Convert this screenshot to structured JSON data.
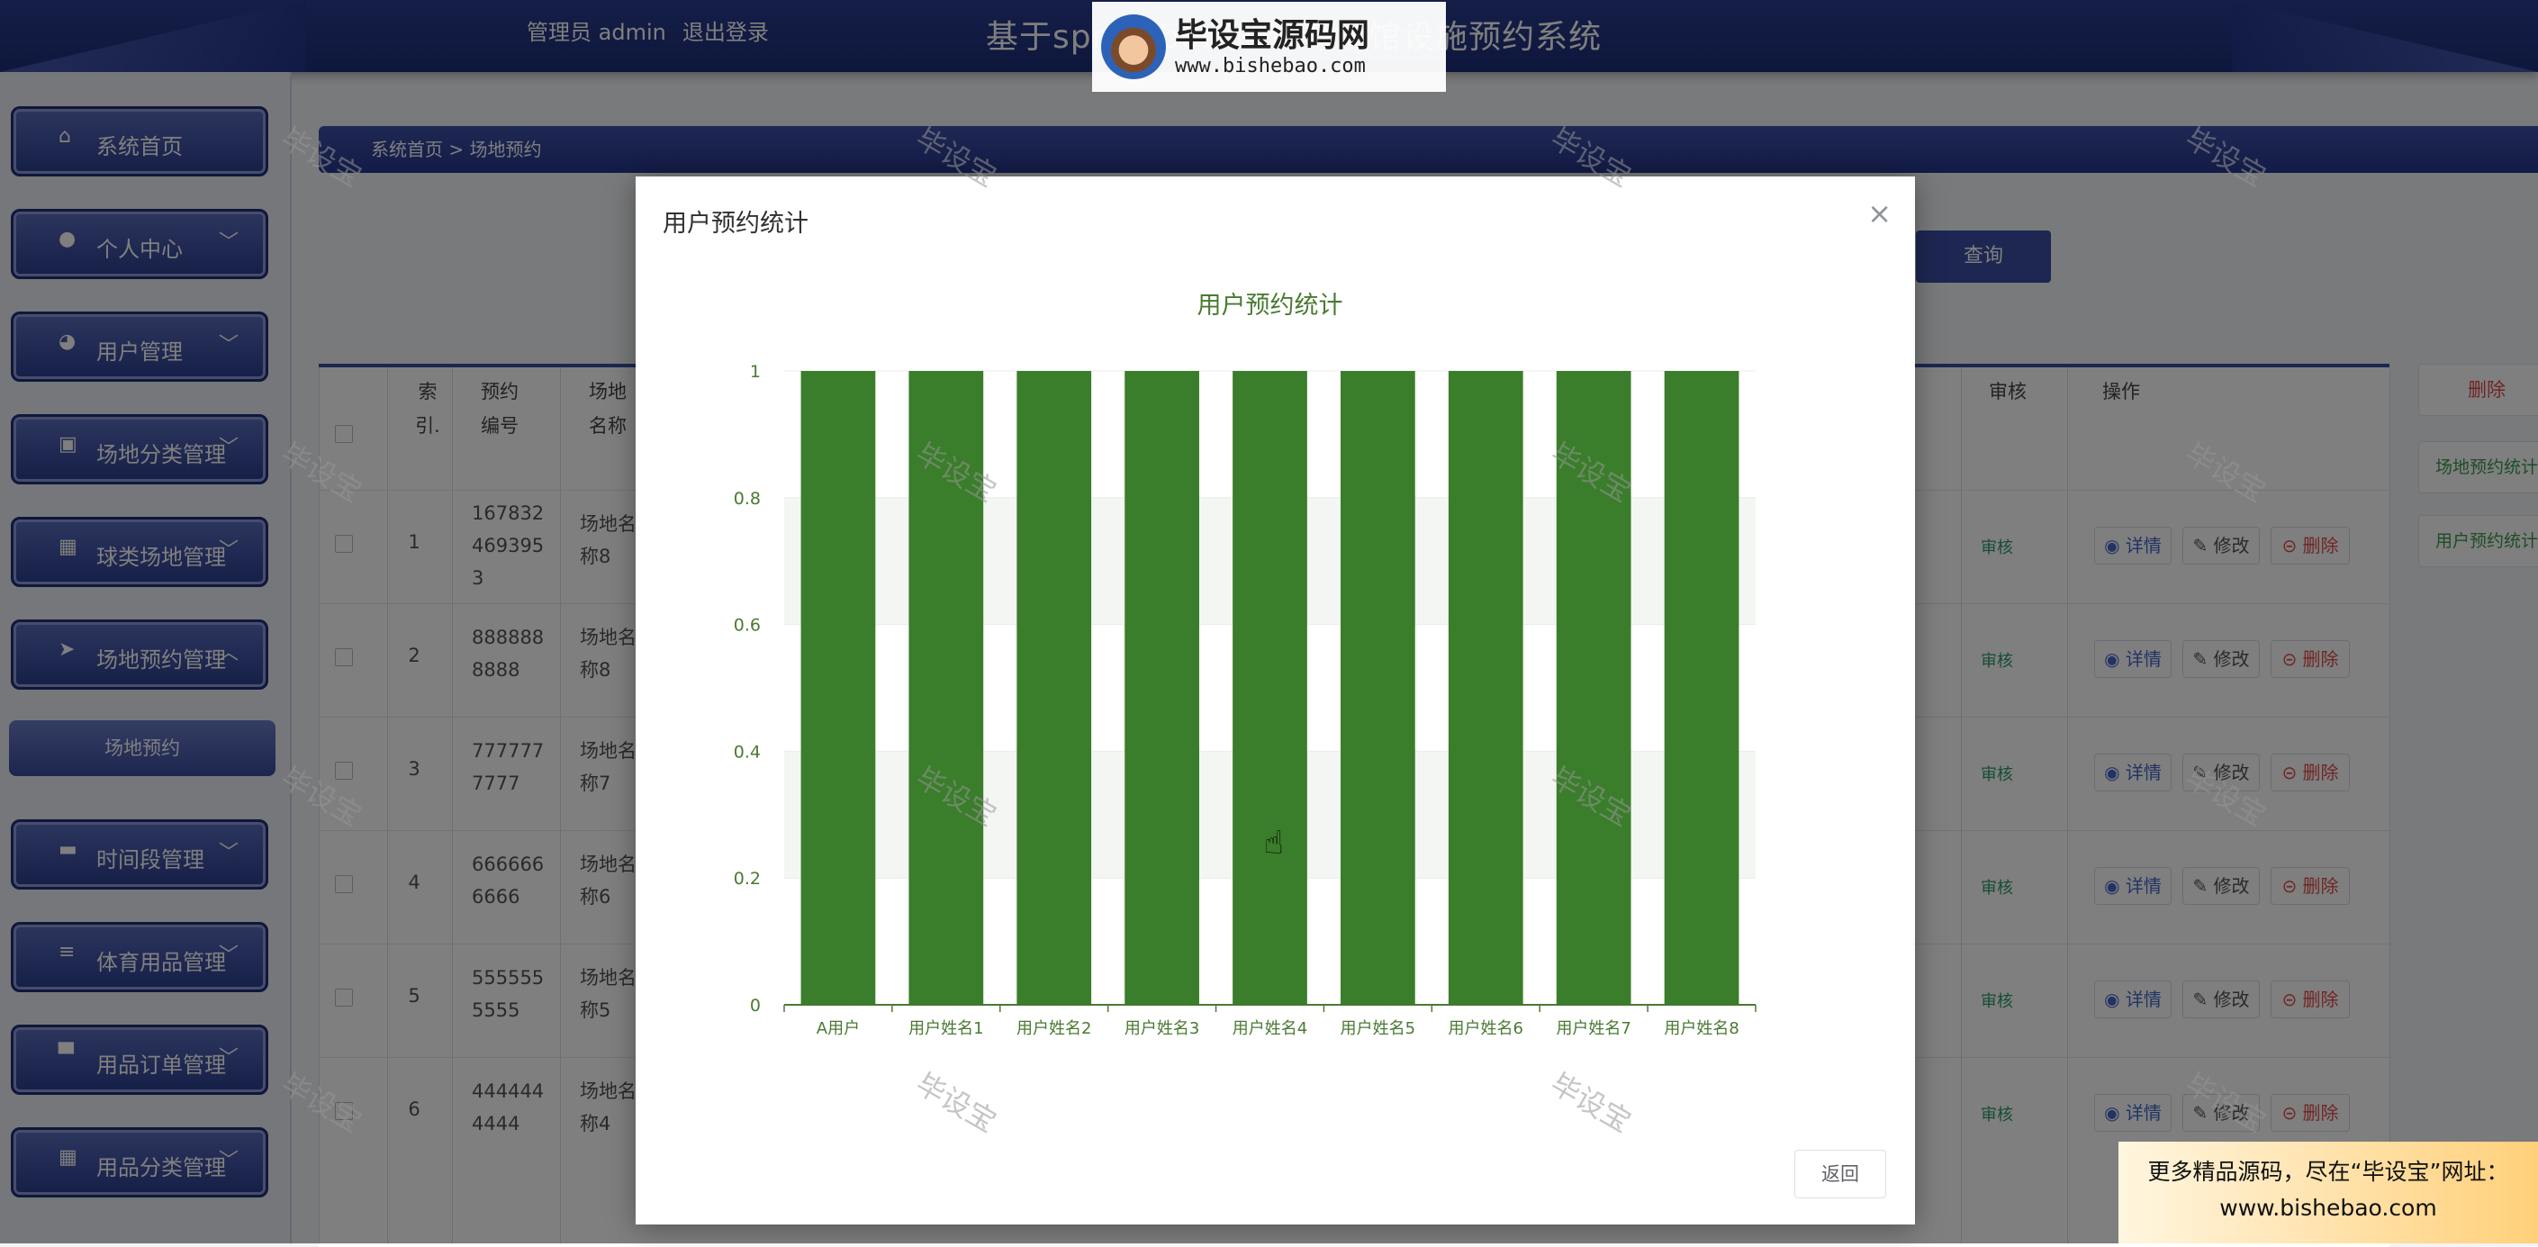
{
  "header": {
    "user_role": "管理员 admin",
    "logout": "退出登录",
    "system_title": "基于springboot的体育场馆设施预约系统"
  },
  "watermark": {
    "logo_title": "毕设宝源码网",
    "logo_url": "www.bishebao.com",
    "tile_text": "毕设宝",
    "corner_ad_line1": "更多精品源码，尽在“毕设宝”网址：",
    "corner_ad_line2": "www.bishebao.com"
  },
  "sidebar": {
    "items": [
      {
        "label": "系统首页",
        "icon": "home-icon",
        "chevron": ""
      },
      {
        "label": "个人中心",
        "icon": "user-icon",
        "chevron": "﹀"
      },
      {
        "label": "用户管理",
        "icon": "palette-icon",
        "chevron": "﹀"
      },
      {
        "label": "场地分类管理",
        "icon": "calendar-x-icon",
        "chevron": "﹀"
      },
      {
        "label": "球类场地管理",
        "icon": "grid-icon",
        "chevron": "﹀"
      },
      {
        "label": "场地预约管理",
        "icon": "send-icon",
        "chevron": "︿"
      },
      {
        "label": "时间段管理",
        "icon": "briefcase-icon",
        "chevron": "﹀"
      },
      {
        "label": "体育用品管理",
        "icon": "list-icon",
        "chevron": "﹀"
      },
      {
        "label": "用品订单管理",
        "icon": "monitor-icon",
        "chevron": "﹀"
      },
      {
        "label": "用品分类管理",
        "icon": "grid-icon",
        "chevron": "﹀"
      }
    ],
    "sub_item": "场地预约"
  },
  "main": {
    "breadcrumb": "系统首页  >  场地预约",
    "query_button": "查询",
    "right_buttons": [
      "删除",
      "场地预约统计",
      "用户预约统计"
    ],
    "columns": {
      "index": "索\n引.",
      "booking_no": "预约\n编号",
      "venue_name": "场地\n名称",
      "audit": "审核",
      "operation": "操作"
    },
    "rows": [
      {
        "index": "1",
        "booking_no": "167832\n469395\n3",
        "venue": "场地名\n称8",
        "audit": "审核"
      },
      {
        "index": "2",
        "booking_no": "888888\n8888",
        "venue": "场地名\n称8",
        "audit": "审核"
      },
      {
        "index": "3",
        "booking_no": "777777\n7777",
        "venue": "场地名\n称7",
        "audit": "审核"
      },
      {
        "index": "4",
        "booking_no": "666666\n6666",
        "venue": "场地名\n称6",
        "audit": "审核"
      },
      {
        "index": "5",
        "booking_no": "555555\n5555",
        "venue": "场地名\n称5",
        "audit": "审核"
      },
      {
        "index": "6",
        "booking_no": "444444\n4444",
        "venue": "场地名\n称4",
        "audit": "审核"
      }
    ],
    "actions": {
      "detail": "◉ 详情",
      "edit": "✎ 修改",
      "delete": "⊝ 删除"
    }
  },
  "modal": {
    "title": "用户预约统计",
    "close": "×",
    "return_button": "返回"
  },
  "chart_data": {
    "type": "bar",
    "title": "用户预约统计",
    "categories": [
      "A用户",
      "用户姓名1",
      "用户姓名2",
      "用户姓名3",
      "用户姓名4",
      "用户姓名5",
      "用户姓名6",
      "用户姓名7",
      "用户姓名8"
    ],
    "values": [
      1,
      1,
      1,
      1,
      1,
      1,
      1,
      1,
      1
    ],
    "ylim": [
      0,
      1
    ],
    "yticks": [
      "0",
      "0.2",
      "0.4",
      "0.6",
      "0.8",
      "1"
    ],
    "grid": true,
    "color": "#3a7d2a",
    "text_color": "#4a7a32"
  }
}
